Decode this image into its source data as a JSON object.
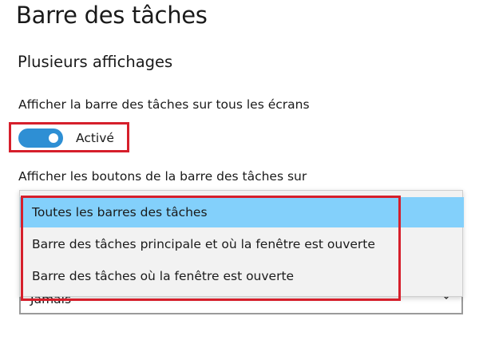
{
  "page": {
    "title": "Barre des tâches"
  },
  "section": {
    "title": "Plusieurs affichages"
  },
  "show_on_all_displays": {
    "label": "Afficher la barre des tâches sur tous les écrans",
    "toggle_state_text": "Activé",
    "toggle_on": true
  },
  "show_buttons_on": {
    "label": "Afficher les boutons de la barre des tâches sur",
    "dropdown_options": [
      "Toutes les barres des tâches",
      "Barre des tâches principale et où la fenêtre est ouverte",
      "Barre des tâches où la fenêtre est ouverte"
    ],
    "highlighted_option_index": 0
  },
  "combine_buttons": {
    "current_value": "Jamais"
  },
  "colors": {
    "accent": "#2e8fd4",
    "highlight_box": "#d61f2b",
    "selected_option_bg": "#83d0fb",
    "dropdown_bg": "#f2f2f2"
  },
  "icons": {
    "select_chevron": "chevron-down-icon"
  }
}
